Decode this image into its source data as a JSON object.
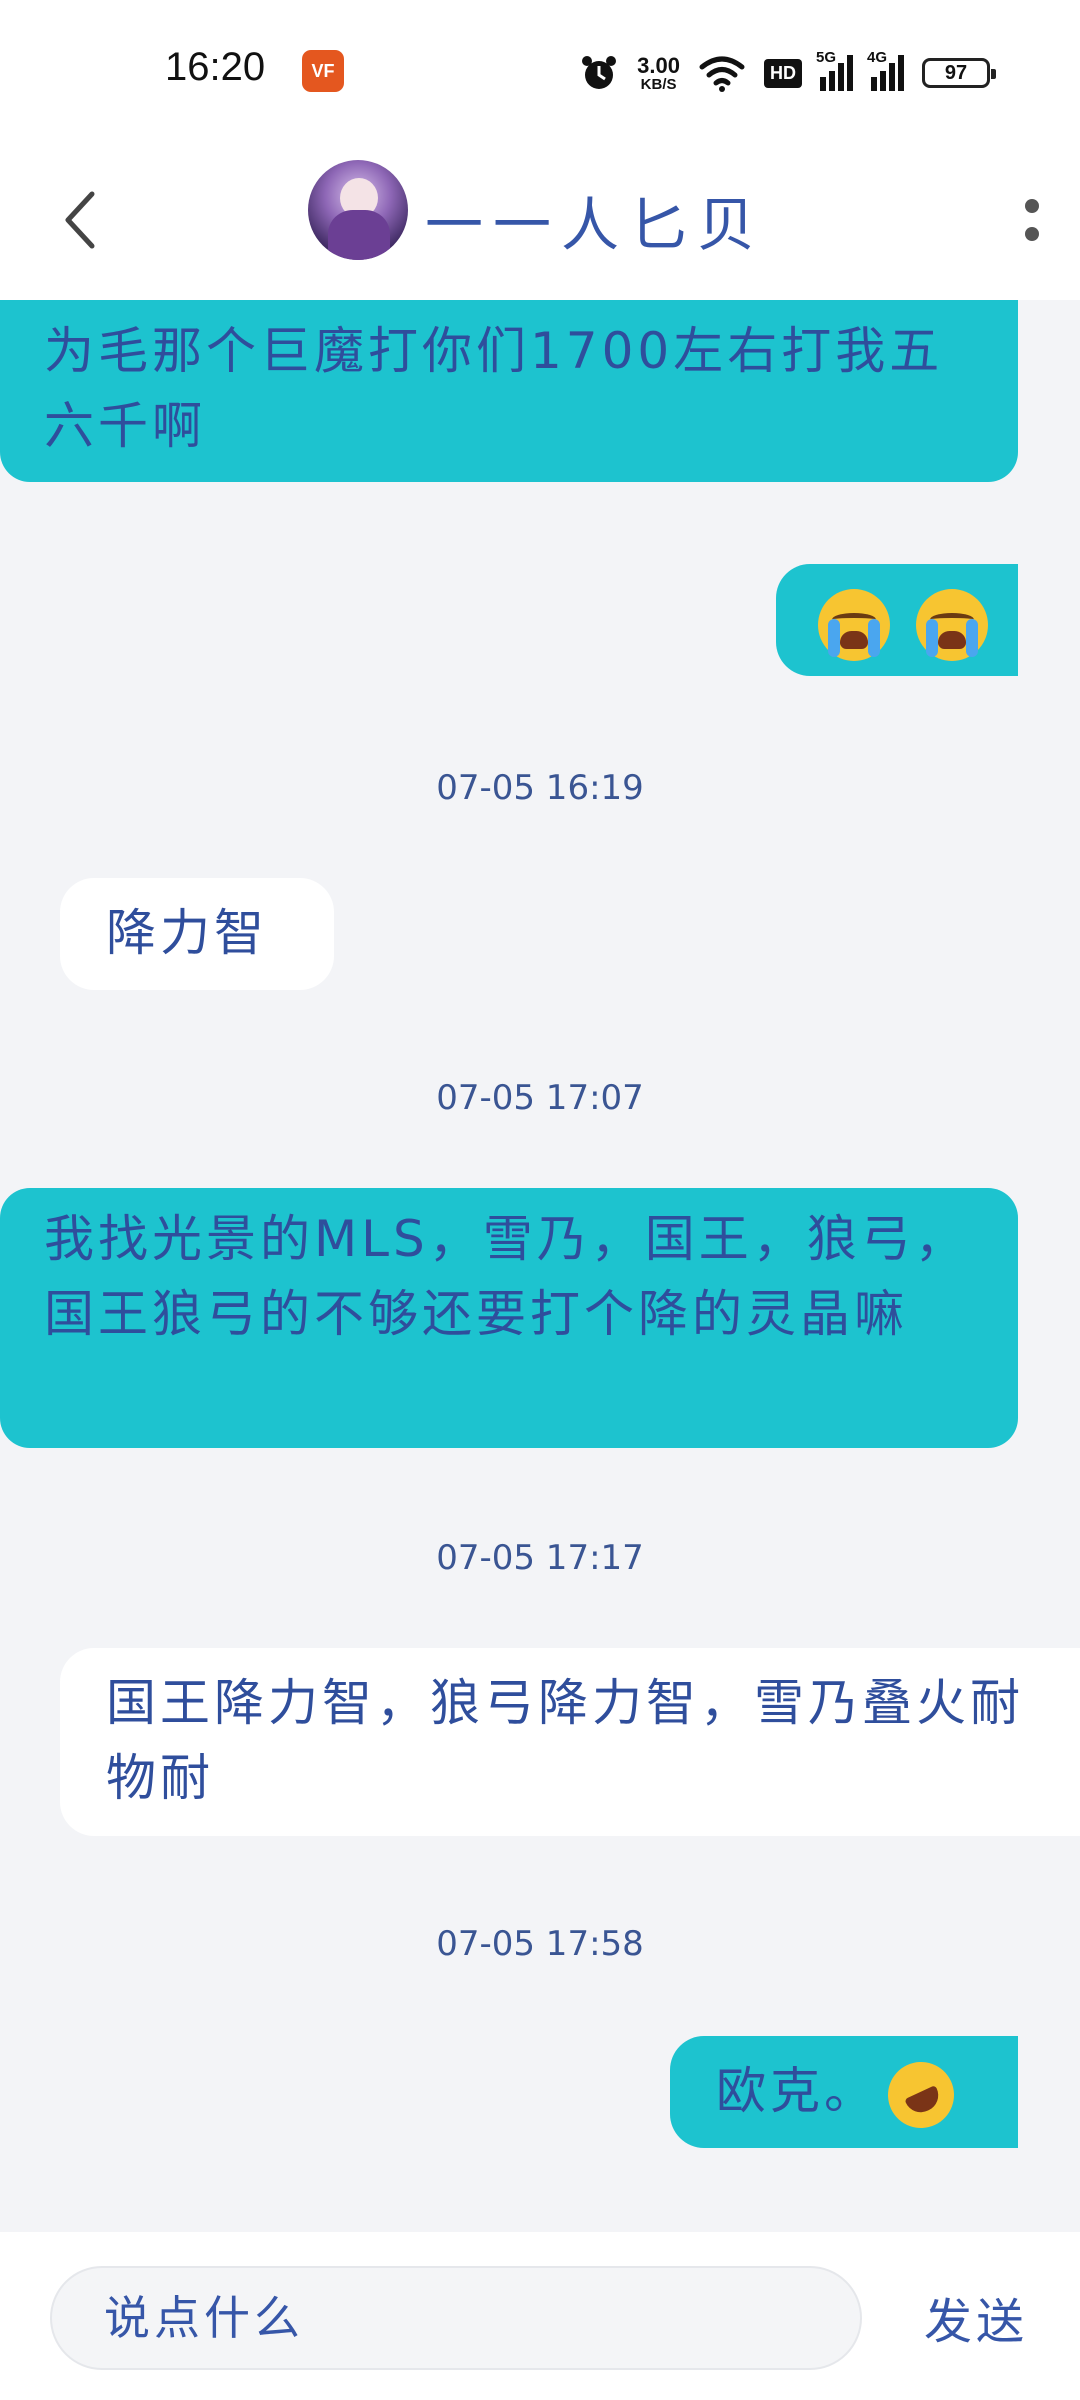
{
  "status_bar": {
    "time": "16:20",
    "app_icon_label": "VF",
    "net_speed_value": "3.00",
    "net_speed_unit": "KB/S",
    "hd_label": "HD",
    "signal_1_label": "5G",
    "signal_2_label": "4G",
    "battery": "97"
  },
  "header": {
    "contact_name": "一一人匕贝"
  },
  "messages": [
    {
      "side": "sent",
      "text": "为毛那个巨魔打你们1700左右打我五六千啊"
    },
    {
      "side": "sent",
      "emoji": "loudly-crying-face x2"
    },
    {
      "timestamp": "07-05 16:19"
    },
    {
      "side": "received",
      "text": "降力智"
    },
    {
      "timestamp": "07-05 17:07"
    },
    {
      "side": "sent",
      "text": "我找光景的MLS，雪乃，国王，狼弓，国王狼弓的不够还要打个降的灵晶嘛"
    },
    {
      "timestamp": "07-05 17:17"
    },
    {
      "side": "received",
      "text": "国王降力智，狼弓降力智，雪乃叠火耐物耐"
    },
    {
      "timestamp": "07-05 17:58"
    },
    {
      "side": "sent",
      "text": "欧克。",
      "emoji": "rolling-on-floor-laughing"
    }
  ],
  "input": {
    "placeholder": "说点什么",
    "send_label": "发送"
  },
  "colors": {
    "sent_bubble": "#1dc3cf",
    "received_bubble": "#ffffff",
    "text": "#2f4e9c",
    "background": "#f3f4f7"
  }
}
